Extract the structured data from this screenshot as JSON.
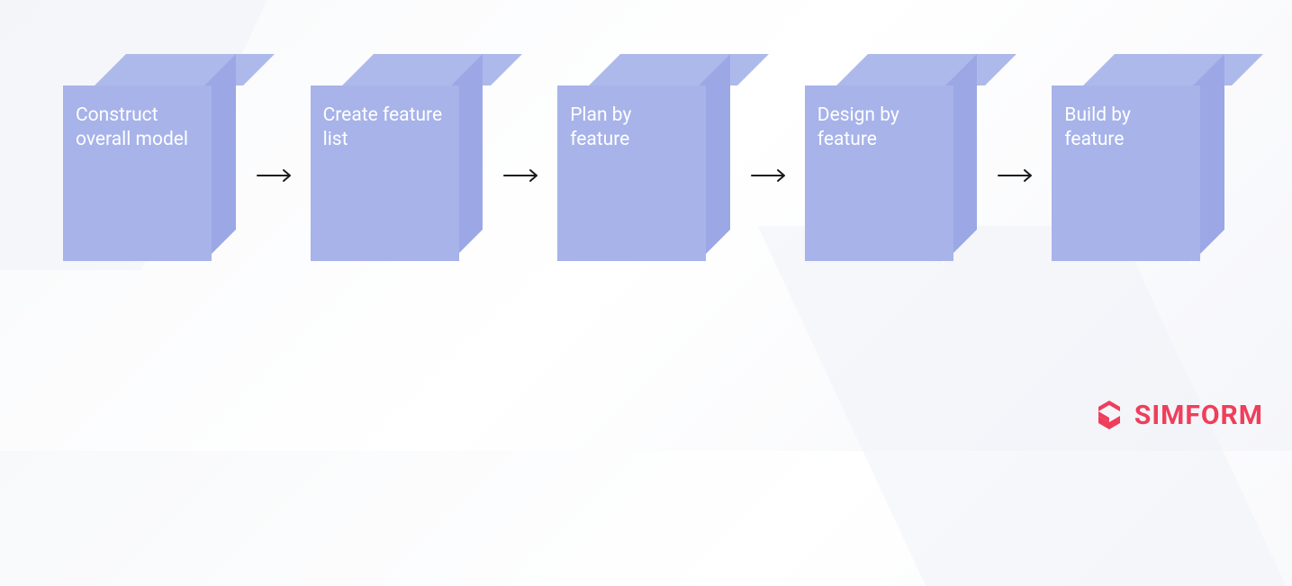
{
  "diagram": {
    "steps": [
      {
        "label": "Construct overall model"
      },
      {
        "label": "Create feature list"
      },
      {
        "label": "Plan by feature"
      },
      {
        "label": "Design by feature"
      },
      {
        "label": "Build by feature"
      }
    ]
  },
  "brand": {
    "name": "SIMFORM",
    "color": "#ef3e5b"
  }
}
